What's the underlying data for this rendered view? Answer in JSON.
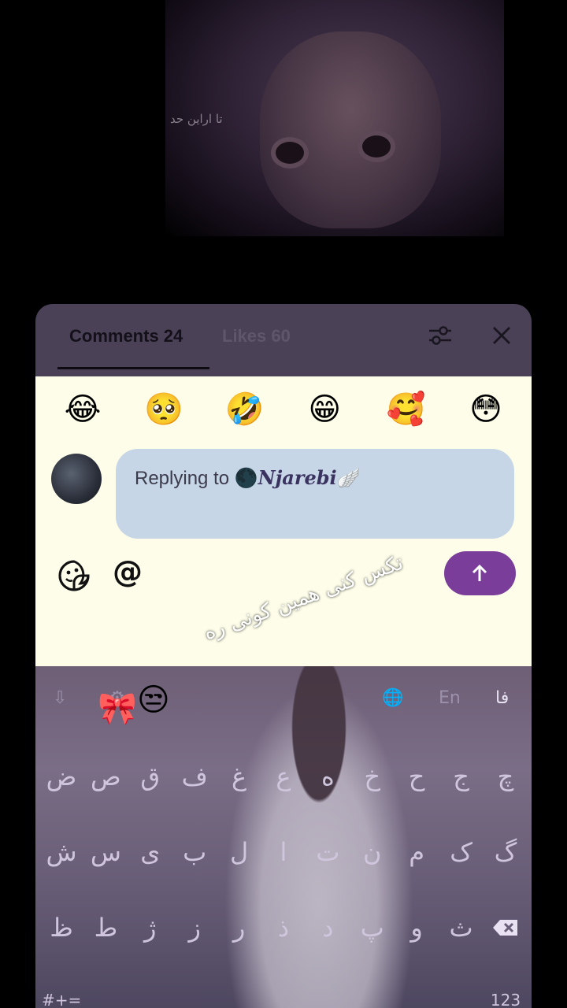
{
  "video": {
    "caption": "تا اراین حد"
  },
  "sheet": {
    "tabs": [
      {
        "label": "Comments 24"
      },
      {
        "label": "Likes 60"
      }
    ],
    "icons": {
      "filter": "sliders-icon",
      "close": "close-icon"
    }
  },
  "quick_emojis": [
    "😂",
    "🥺",
    "🤣",
    "😁",
    "🥰",
    "😳"
  ],
  "reply": {
    "prefix": "Replying to ",
    "emoji": "🌑",
    "name": "𝑵𝒋𝒂𝒓𝒆𝒃𝒊",
    "wing": "🪽"
  },
  "composer": {
    "sticker_icon": "sticker-icon",
    "at_label": "@",
    "send_icon": "arrow-up-icon"
  },
  "keyboard": {
    "toolbar": [
      "⇩",
      "⚙",
      "🌐",
      "En",
      "فا"
    ],
    "row1": [
      "ض",
      "ص",
      "ق",
      "ف",
      "غ",
      "ع",
      "ه",
      "خ",
      "ح",
      "ج",
      "چ"
    ],
    "row2": [
      "ش",
      "س",
      "ی",
      "ب",
      "ل",
      "ا",
      "ت",
      "ن",
      "م",
      "ک",
      "گ"
    ],
    "row3": [
      "ظ",
      "ط",
      "ژ",
      "ز",
      "ر",
      "ذ",
      "د",
      "پ",
      "و",
      "ث"
    ],
    "row4_left": "#+=",
    "row4_num": "123"
  },
  "overlay": {
    "text": "تکس کنی همین کونی ره",
    "bow": "🎀",
    "smirk": "😒"
  },
  "colors": {
    "sheet_header": "#4a4156",
    "sheet_body": "#fdfde9",
    "reply_box": "#c6d6e6",
    "send_button": "#7a3e9a"
  }
}
